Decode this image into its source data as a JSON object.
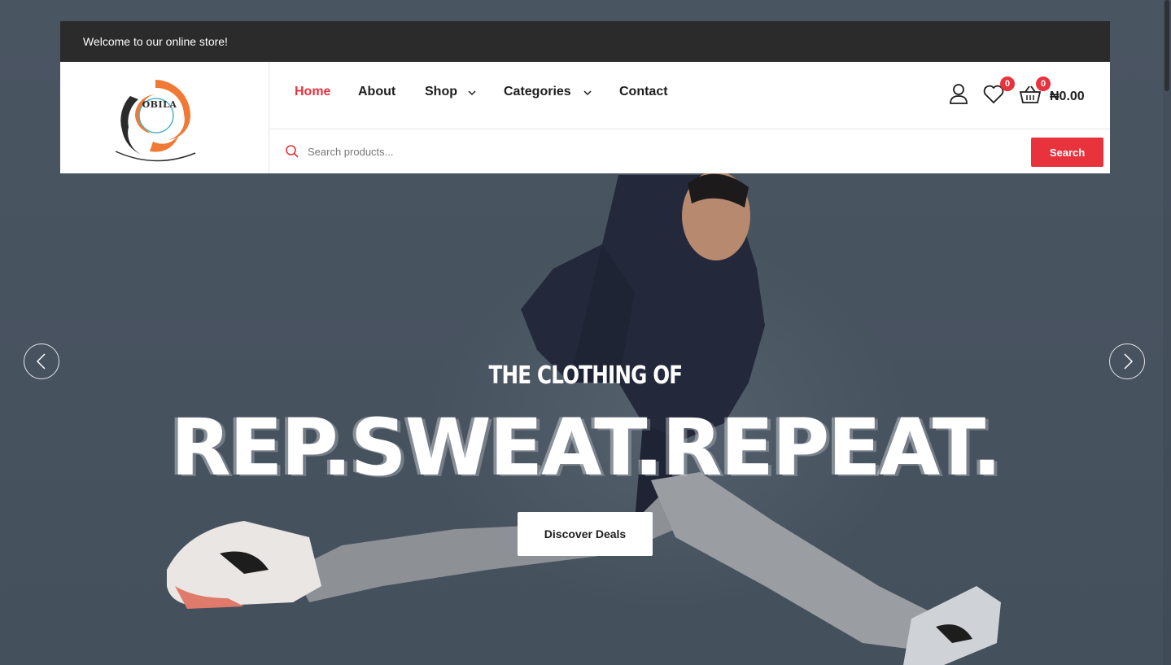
{
  "topbar": {
    "welcome": "Welcome to our online store!"
  },
  "brand": {
    "name": "OBILA",
    "colors": {
      "orange": "#f07a35",
      "dark": "#2b2b2b"
    }
  },
  "nav": {
    "items": [
      {
        "label": "Home",
        "active": true
      },
      {
        "label": "About"
      },
      {
        "label": "Shop",
        "has_dropdown": true
      },
      {
        "label": "Categories",
        "has_dropdown": true
      },
      {
        "label": "Contact"
      }
    ]
  },
  "header_actions": {
    "account_icon": "user-icon",
    "wishlist": {
      "icon": "heart-icon",
      "count": "0"
    },
    "cart": {
      "icon": "basket-icon",
      "count": "0",
      "total": "₦0.00"
    }
  },
  "search": {
    "placeholder": "Search products...",
    "button_label": "Search"
  },
  "hero": {
    "subtitle": "THE CLOTHING OF",
    "title": "REP.SWEAT.REPEAT.",
    "cta_label": "Discover Deals",
    "prev_icon": "chevron-left-icon",
    "next_icon": "chevron-right-icon"
  },
  "colors": {
    "accent": "#e8323c",
    "topbar_bg": "#2b2b2b",
    "hero_bg": "#4a5562"
  }
}
